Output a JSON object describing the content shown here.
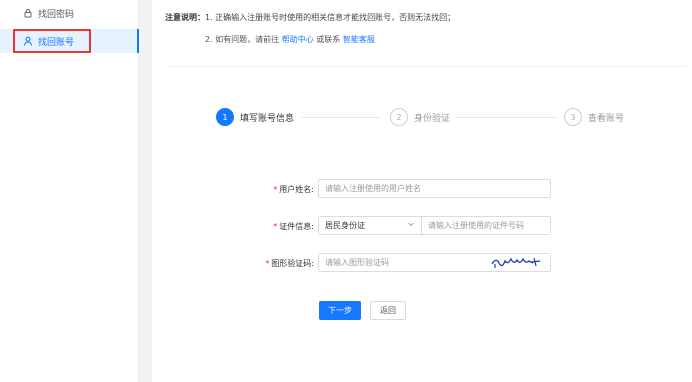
{
  "sidebar": {
    "items": [
      {
        "label": "找回密码",
        "icon": "lock-icon"
      },
      {
        "label": "找回账号",
        "icon": "user-icon"
      }
    ]
  },
  "notice": {
    "title": "注意说明：",
    "line1": "1. 正确输入注册账号时使用的相关信息才能找回账号，否则无法找回；",
    "line2_prefix": "2. 如有问题，请前往",
    "line2_link1": "帮助中心",
    "line2_mid": "或联系",
    "line2_link2": "智能客服"
  },
  "steps": [
    {
      "num": "1",
      "label": "填写账号信息"
    },
    {
      "num": "2",
      "label": "身份验证"
    },
    {
      "num": "3",
      "label": "查看账号"
    }
  ],
  "form": {
    "username": {
      "label": "用户姓名:",
      "placeholder": "请输入注册使用的用户姓名"
    },
    "id_info": {
      "label": "证件信息:",
      "select_value": "居民身份证",
      "placeholder": "请输入注册使用的证件号码"
    },
    "captcha": {
      "label": "图形验证码:",
      "placeholder": "请输入图形验证码",
      "image_text": "pmu"
    }
  },
  "buttons": {
    "next": "下一步",
    "back": "返回"
  },
  "colors": {
    "accent": "#1677ff",
    "required": "#f5222d",
    "highlight": "#e53935"
  }
}
